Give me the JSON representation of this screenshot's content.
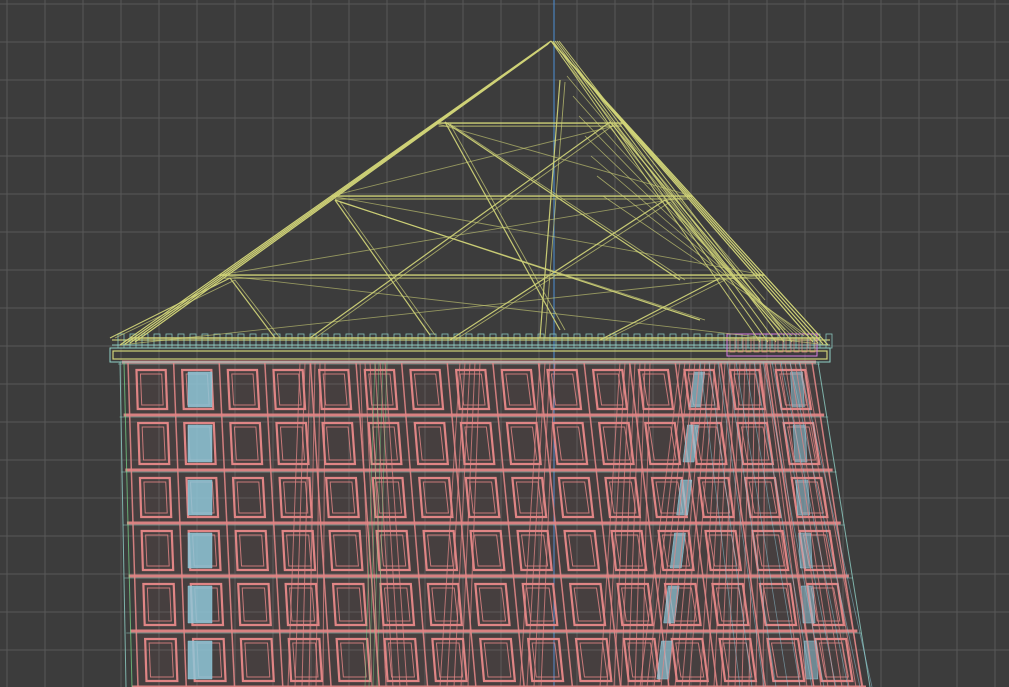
{
  "viewport": {
    "background_color": "#3c3c3c",
    "grid_color": "#5a5a5a",
    "axis_color": "#4d8fd6",
    "grid_visible": true,
    "axis_visible": true
  },
  "model": {
    "render_mode": "wireframe",
    "roof_wire_color": "#cfd277",
    "wall_wire_color": "#e08585",
    "wall_fill_color": "#c26a6a",
    "glass_color": "#8fc7d8",
    "cornice_wire_color": "#8fd0c6",
    "edge_accent_color": "#7cdc8c",
    "highlight_color": "#d97ee0"
  }
}
